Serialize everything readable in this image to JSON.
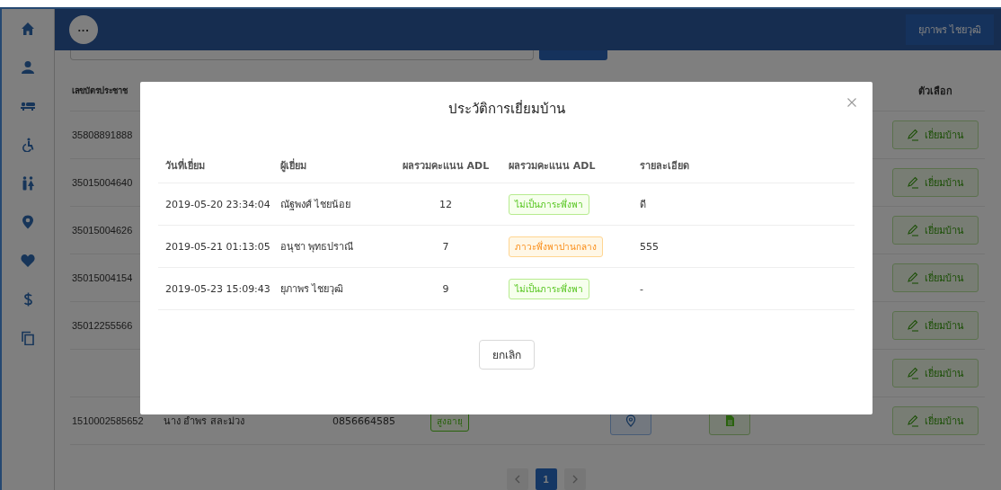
{
  "topbar": {
    "menu_button": "···",
    "user_button": "ยุภาพร ไชยวุฒิ"
  },
  "patients": {
    "columns": [
      {
        "label": "เลขบัตรประชาช",
        "kind": "id"
      },
      {
        "label": "ตัวเลือก",
        "kind": "options"
      }
    ],
    "rows": [
      {
        "kind": "covered",
        "id": "35808891888",
        "visit_button": "เยี่ยมบ้าน"
      },
      {
        "kind": "covered",
        "id": "35015004640",
        "visit_button": "เยี่ยมบ้าน"
      },
      {
        "kind": "covered",
        "id": "35015004626",
        "visit_button": "เยี่ยมบ้าน"
      },
      {
        "kind": "covered",
        "id": "35015004154",
        "visit_button": "เยี่ยมบ้าน"
      },
      {
        "kind": "covered",
        "id": "35012255566",
        "visit_button": "เยี่ยมบ้าน"
      },
      {
        "kind": "hidden",
        "visit_button": "เยี่ยมบ้าน"
      },
      {
        "kind": "full",
        "id": "1510002585652",
        "name": "นาง อำพร สละม่วง",
        "phone": "0856664585",
        "tags": [
          "สูงอายุ"
        ],
        "visit_button": "เยี่ยมบ้าน"
      }
    ]
  },
  "pagination": {
    "pages": [
      {
        "label": "1",
        "selected": true
      }
    ]
  },
  "modal": {
    "title": "ประวัติการเยี่ยมบ้าน",
    "columns": [
      "วันที่เยี่ยม",
      "ผู้เยี่ยม",
      "ผลรวมคะแนน ADL",
      "ผลรวมคะแนน ADL",
      "รายละเอียด"
    ],
    "rows": [
      {
        "date": "2019-05-20 23:34:04",
        "visitor": "ณัฐพงศ์ ไชยน้อย",
        "score": "12",
        "status": {
          "label": "ไม่เป็นภาระพึ่งพา",
          "kind": "independent",
          "color": "#b7eb8f"
        },
        "detail": "ดี"
      },
      {
        "date": "2019-05-21 01:13:05",
        "visitor": "อนุชา พุทธปราณี",
        "score": "7",
        "status": {
          "label": "ภาวะพึ่งพาปานกลาง",
          "kind": "moderate",
          "color": "#ffd591"
        },
        "detail": "555"
      },
      {
        "date": "2019-05-23 15:09:43",
        "visitor": "ยุภาพร ไชยวุฒิ",
        "score": "9",
        "status": {
          "label": "ไม่เป็นภาระพึ่งพา",
          "kind": "independent",
          "color": "#b7eb8f"
        },
        "detail": "-"
      }
    ],
    "cancel_button": "ยกเลิก"
  }
}
